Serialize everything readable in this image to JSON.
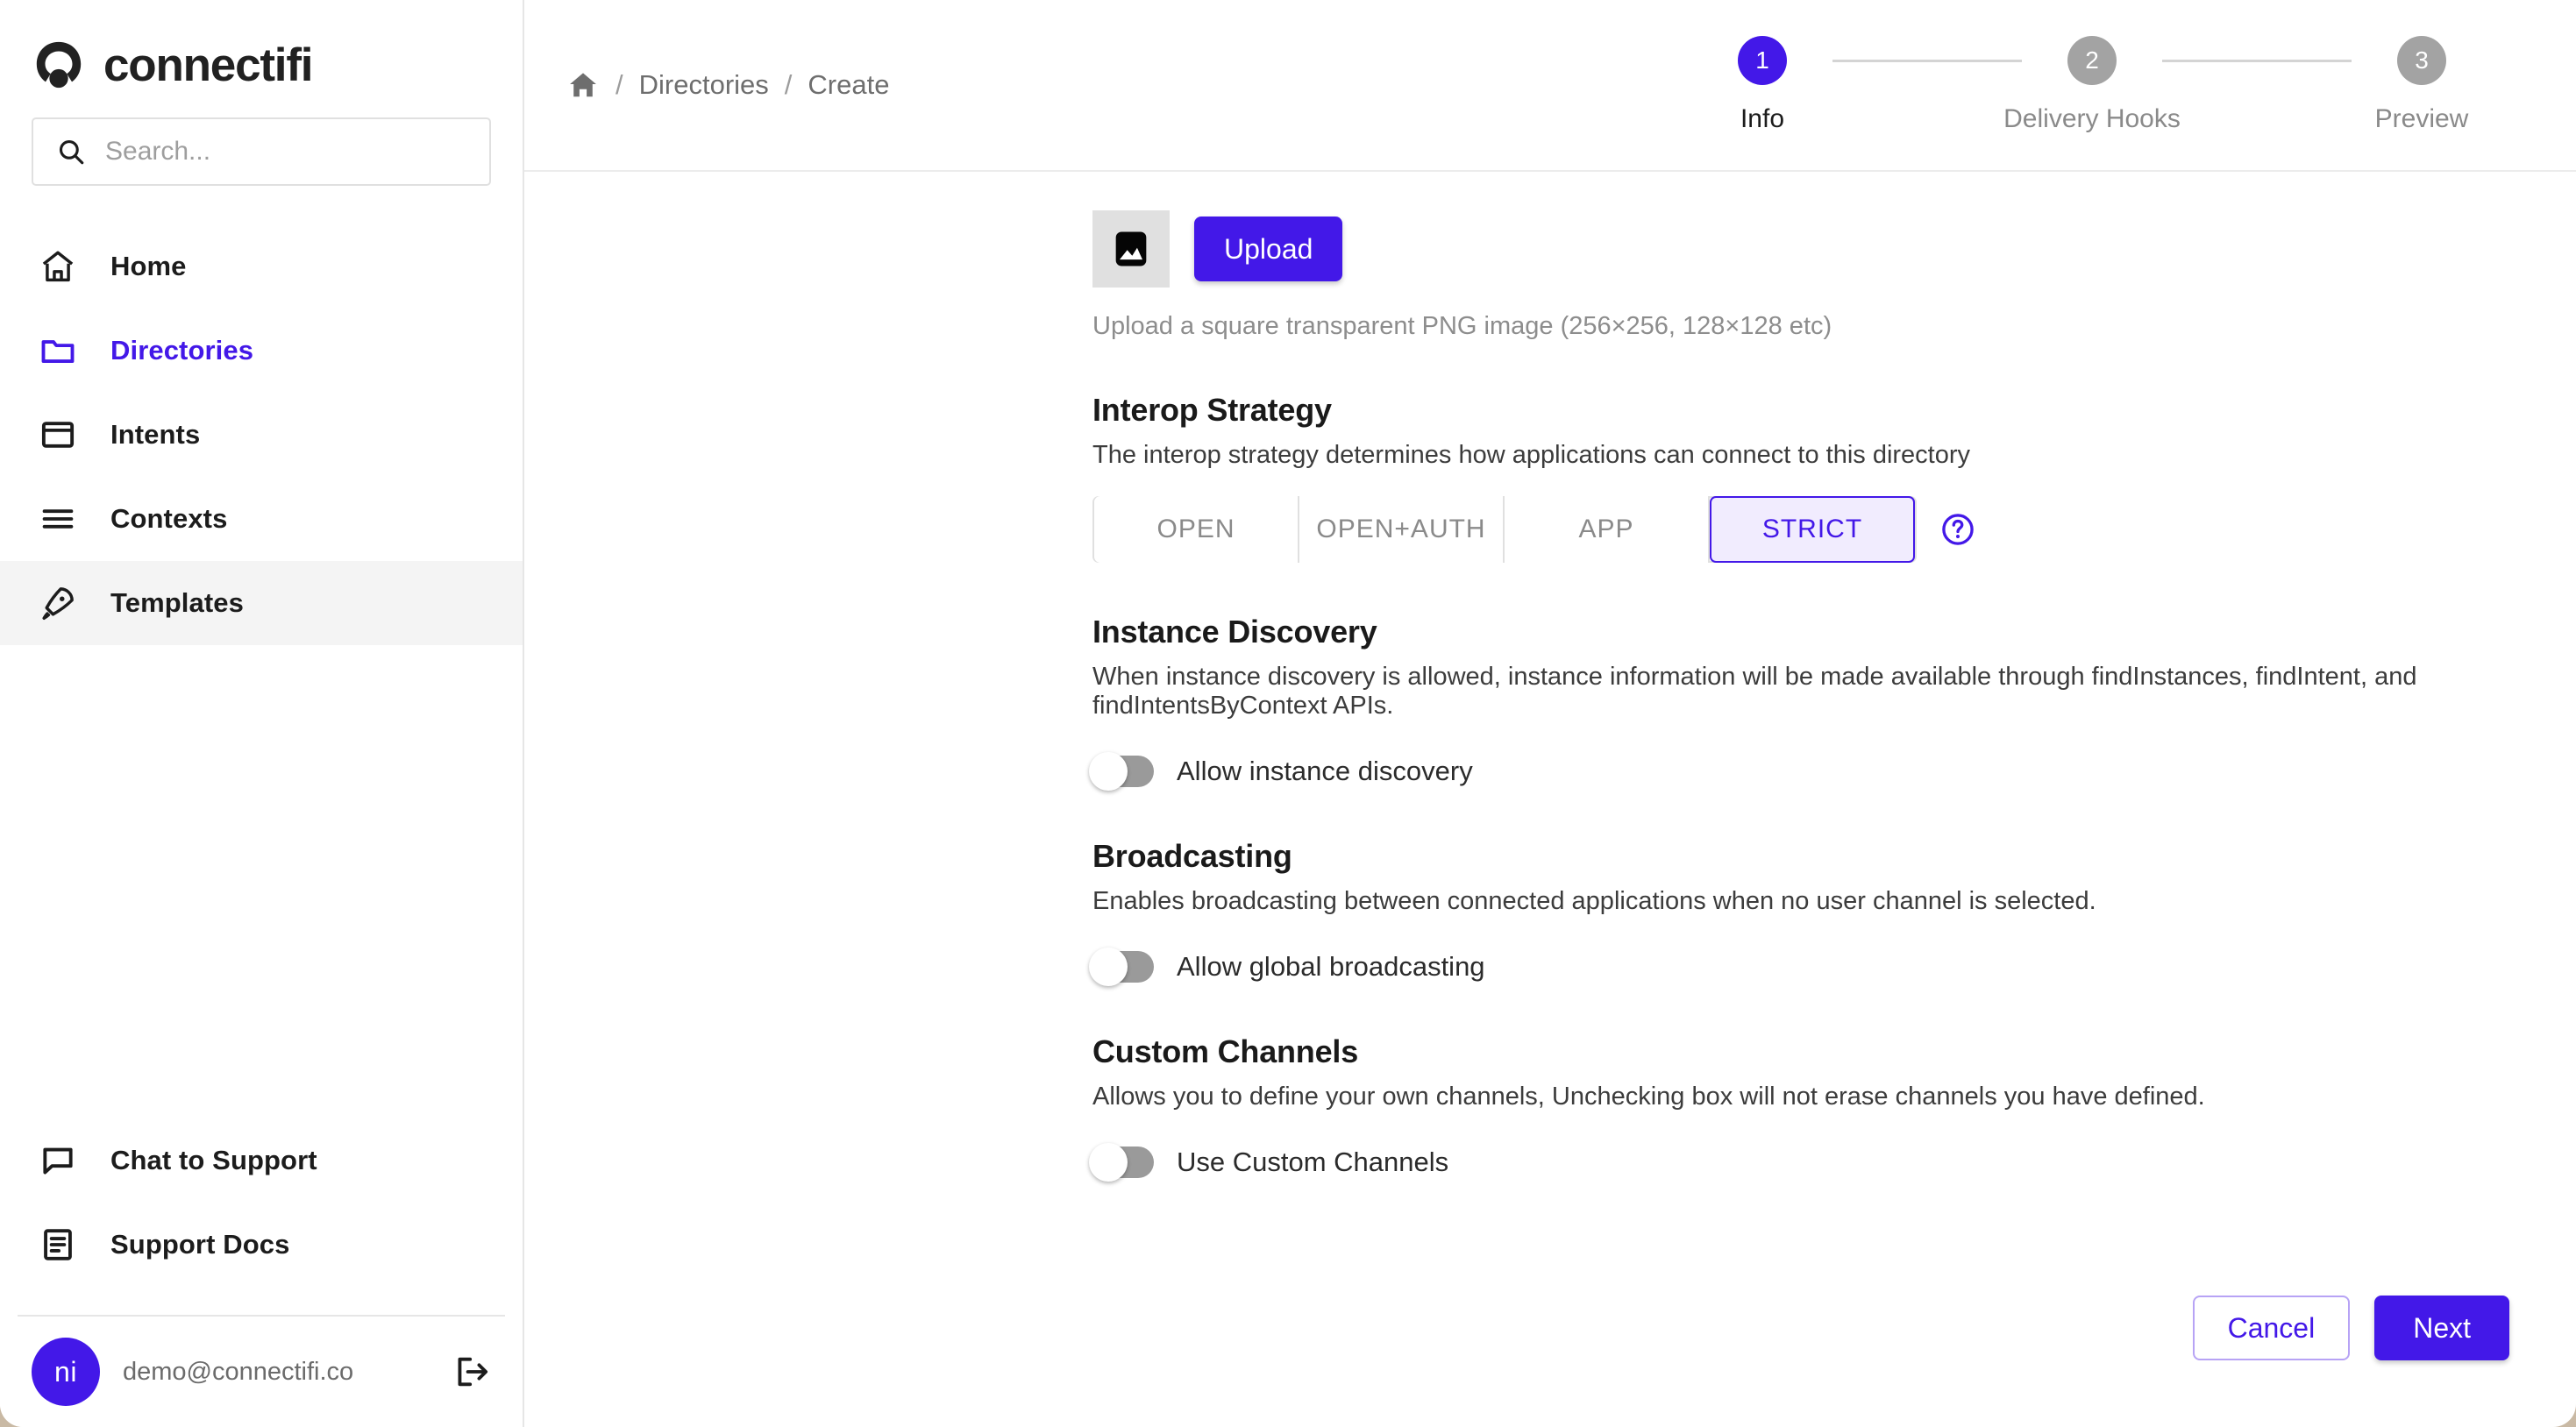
{
  "brand": {
    "name": "connectifi",
    "logo_icon": "connectifi-logo-icon"
  },
  "search": {
    "placeholder": "Search...",
    "value": "",
    "icon": "search-icon"
  },
  "sidebar": {
    "items": [
      {
        "label": "Home",
        "icon": "home-icon",
        "active": false
      },
      {
        "label": "Directories",
        "icon": "folder-icon",
        "active": true
      },
      {
        "label": "Intents",
        "icon": "window-icon",
        "active": false
      },
      {
        "label": "Contexts",
        "icon": "list-icon",
        "active": false
      },
      {
        "label": "Templates",
        "icon": "rocket-icon",
        "active": false
      }
    ],
    "support": [
      {
        "label": "Chat to Support",
        "icon": "chat-bubble-icon"
      },
      {
        "label": "Support Docs",
        "icon": "document-icon"
      }
    ],
    "account": {
      "initials": "ni",
      "email": "demo@connectifi.co",
      "logout_icon": "logout-icon"
    }
  },
  "breadcrumb": {
    "home_icon": "home-icon",
    "separator": "/",
    "items": [
      "Directories",
      "Create"
    ]
  },
  "stepper": {
    "steps": [
      {
        "number": "1",
        "label": "Info",
        "active": true
      },
      {
        "number": "2",
        "label": "Delivery Hooks",
        "active": false
      },
      {
        "number": "3",
        "label": "Preview",
        "active": false
      }
    ]
  },
  "upload": {
    "placeholder_icon": "image-placeholder-icon",
    "button_label": "Upload",
    "hint": "Upload a square transparent PNG image (256×256, 128×128 etc)"
  },
  "interop": {
    "title": "Interop Strategy",
    "description": "The interop strategy determines how applications can connect to this directory",
    "tabs": [
      {
        "label": "OPEN",
        "selected": false
      },
      {
        "label": "OPEN+AUTH",
        "selected": false
      },
      {
        "label": "APP",
        "selected": false
      },
      {
        "label": "STRICT",
        "selected": true
      }
    ],
    "help_icon": "help-circle-icon"
  },
  "instance_discovery": {
    "title": "Instance Discovery",
    "description": "When instance discovery is allowed, instance information will be made available through findInstances, findIntent, and findIntentsByContext APIs.",
    "toggle_label": "Allow instance discovery",
    "toggle_on": false
  },
  "broadcasting": {
    "title": "Broadcasting",
    "description": "Enables broadcasting between connected applications when no user channel is selected.",
    "toggle_label": "Allow global broadcasting",
    "toggle_on": false
  },
  "custom_channels": {
    "title": "Custom Channels",
    "description": "Allows you to define your own channels, Unchecking box will not erase channels you have defined.",
    "toggle_label": "Use Custom Channels",
    "toggle_on": false
  },
  "footer": {
    "cancel_label": "Cancel",
    "next_label": "Next"
  },
  "colors": {
    "accent": "#4318e8",
    "accent_light": "#f1ecfe",
    "page_background": "#c9b9a4",
    "muted_text": "#8a8a8a"
  }
}
